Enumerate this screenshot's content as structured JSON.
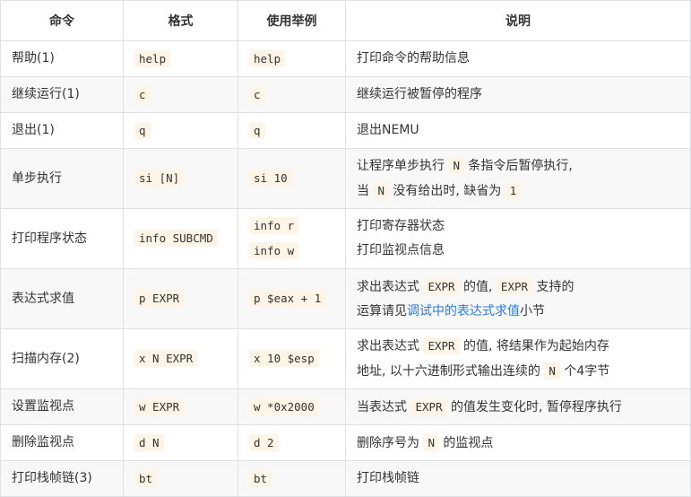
{
  "headers": [
    "命令",
    "格式",
    "使用举例",
    "说明"
  ],
  "rows": [
    {
      "cmd": "帮助(1)",
      "format": "help",
      "examples": [
        "help"
      ],
      "desc": "打印命令的帮助信息"
    },
    {
      "cmd": "继续运行(1)",
      "format": "c",
      "examples": [
        "c"
      ],
      "desc": "继续运行被暂停的程序"
    },
    {
      "cmd": "退出(1)",
      "format": "q",
      "examples": [
        "q"
      ],
      "desc": "退出NEMU"
    },
    {
      "cmd": "单步执行",
      "format": "si [N]",
      "examples": [
        "si 10"
      ],
      "desc_lines": [
        {
          "t1": "让程序单步执行 ",
          "c1": "N",
          "t2": " 条指令后暂停执行,"
        },
        {
          "t1": "当 ",
          "c1": "N",
          "t2": " 没有给出时, 缺省为 ",
          "c2": "1"
        }
      ]
    },
    {
      "cmd": "打印程序状态",
      "format": "info SUBCMD",
      "examples": [
        "info r",
        "info w"
      ],
      "desc_plain": [
        "打印寄存器状态",
        "打印监视点信息"
      ]
    },
    {
      "cmd": "表达式求值",
      "format": "p EXPR",
      "examples": [
        "p $eax + 1"
      ],
      "desc_lines": [
        {
          "t1": "求出表达式 ",
          "c1": "EXPR",
          "t2": " 的值, ",
          "c2": "EXPR",
          "t3": " 支持的"
        },
        {
          "t1": "运算请见",
          "link": "调试中的表达式求值",
          "t2": "小节"
        }
      ]
    },
    {
      "cmd": "扫描内存(2)",
      "format": "x N EXPR",
      "examples": [
        "x 10 $esp"
      ],
      "desc_lines": [
        {
          "t1": "求出表达式 ",
          "c1": "EXPR",
          "t2": " 的值, 将结果作为起始内存"
        },
        {
          "t1": "地址, 以十六进制形式输出连续的 ",
          "c1": "N",
          "t2": " 个4字节"
        }
      ]
    },
    {
      "cmd": "设置监视点",
      "format": "w EXPR",
      "examples": [
        "w *0x2000"
      ],
      "desc_lines": [
        {
          "t1": "当表达式 ",
          "c1": "EXPR",
          "t2": " 的值发生变化时, 暂停程序执行"
        }
      ]
    },
    {
      "cmd": "删除监视点",
      "format": "d N",
      "examples": [
        "d 2"
      ],
      "desc_lines": [
        {
          "t1": "删除序号为 ",
          "c1": "N",
          "t2": " 的监视点"
        }
      ]
    },
    {
      "cmd": "打印栈帧链(3)",
      "format": "bt",
      "examples": [
        "bt"
      ],
      "desc": "打印栈帧链"
    }
  ],
  "colors": {
    "border": "#dfe2e5",
    "stripe": "#f8f8f8",
    "code_bg": "#fff5e6",
    "link": "#2a7ae2"
  }
}
